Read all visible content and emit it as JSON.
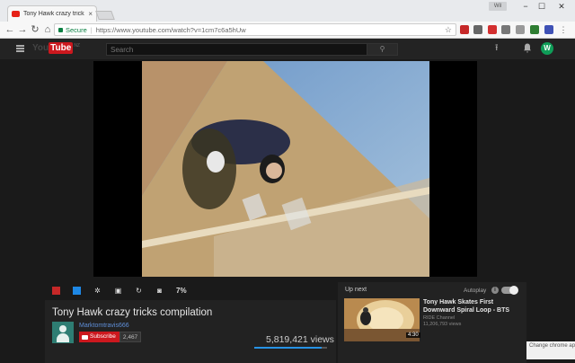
{
  "browser": {
    "tab_title": "Tony Hawk crazy tricks co",
    "tab_close": "×",
    "profile_label": "Wil",
    "window_controls": [
      "−",
      "☐",
      "✕"
    ],
    "secure_label": "Secure",
    "url": "https://www.youtube.com/watch?v=1cm7c6a5hUw",
    "nav": {
      "back": "←",
      "forward": "→",
      "reload": "↻",
      "home": "⌂"
    },
    "star": "☆"
  },
  "youtube": {
    "logo_you": "You",
    "logo_tube": "Tube",
    "logo_region": "NZ",
    "search_placeholder": "Search",
    "search_icon": "⚲",
    "avatar_letter": "W",
    "controls": {
      "zoom_percent": "7%"
    },
    "video": {
      "title": "Tony Hawk crazy tricks compilation",
      "channel": "Marktomtravis666",
      "subscribe_label": "Subscribe",
      "subscriber_count": "2,467",
      "views": "5,819,421 views",
      "like_ratio": 0.92
    },
    "up_next": {
      "label": "Up next",
      "autoplay_label": "Autoplay",
      "autoplay_info": "i",
      "autoplay_on": true,
      "item": {
        "title": "Tony Hawk Skates First Downward Spiral Loop - BTS",
        "channel": "RIDE Channel",
        "views": "11,206,793 views",
        "duration": "4:30"
      }
    },
    "side_panel_text": "Change chrome app to spinning circular"
  },
  "colors": {
    "yt_red": "#cc181e",
    "secure_green": "#0b8043",
    "link_blue": "#5f8fd8",
    "avatar_green": "#0f9d58"
  }
}
